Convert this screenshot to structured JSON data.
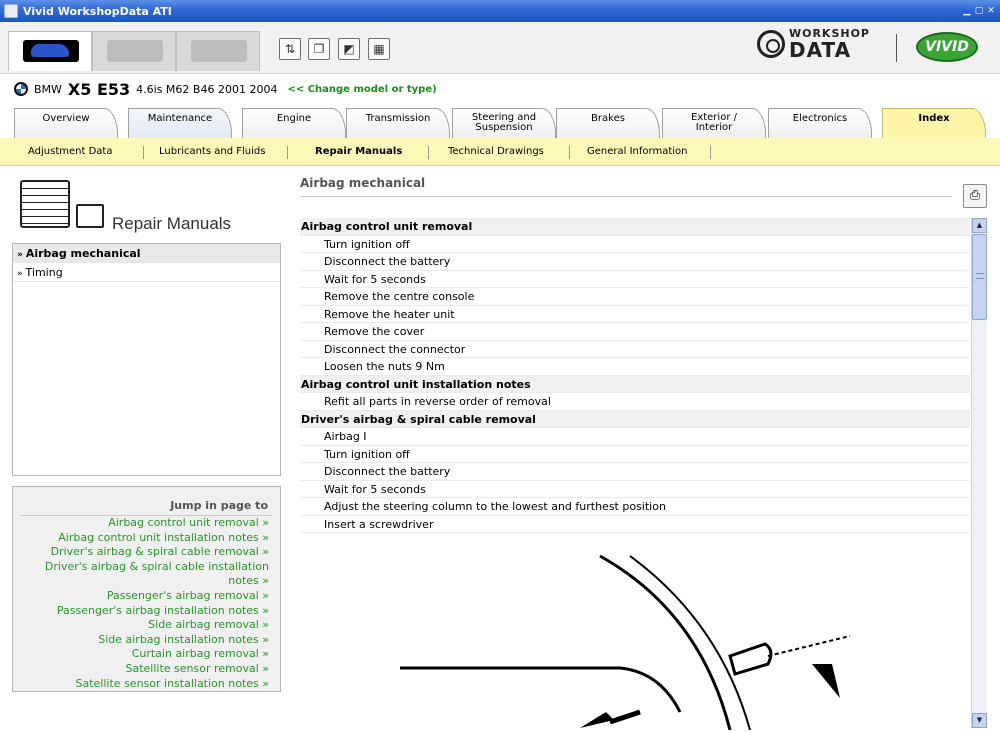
{
  "window": {
    "title": "Vivid WorkshopData ATI"
  },
  "brand": {
    "line1": "WORKSHOP",
    "line2": "DATA",
    "vivid": "VIVID"
  },
  "model": {
    "make": "BMW",
    "name": "X5 E53",
    "detail": "4.6is M62 B46 2001 2004",
    "change_link": "<< Change model or type)"
  },
  "main_tabs": [
    {
      "label": "Overview"
    },
    {
      "label": "Maintenance"
    },
    {
      "label": "Engine"
    },
    {
      "label": "Transmission"
    },
    {
      "label": "Steering and Suspension"
    },
    {
      "label": "Brakes"
    },
    {
      "label": "Exterior / Interior"
    },
    {
      "label": "Electronics"
    },
    {
      "label": "Index"
    }
  ],
  "sub_tabs": [
    {
      "label": "Adjustment Data"
    },
    {
      "label": "Lubricants and Fluids"
    },
    {
      "label": "Repair Manuals"
    },
    {
      "label": "Technical Drawings"
    },
    {
      "label": "General Information"
    }
  ],
  "left": {
    "heading": "Repair Manuals",
    "items": [
      {
        "label": "Airbag mechanical"
      },
      {
        "label": "Timing"
      }
    ],
    "jump_title": "Jump in page to",
    "jump_links": [
      "Airbag control unit removal »",
      "Airbag control unit installation notes »",
      "Driver's airbag & spiral cable removal »",
      "Driver's airbag & spiral cable installation",
      "notes »",
      "Passenger's airbag removal »",
      "Passenger's airbag installation notes »",
      "Side airbag removal »",
      "Side airbag installation notes »",
      "Curtain airbag removal »",
      "Satellite sensor removal »",
      "Satellite sensor installation notes »"
    ]
  },
  "content": {
    "title": "Airbag mechanical",
    "rows": [
      {
        "type": "head",
        "text": "Airbag control unit removal"
      },
      {
        "type": "step",
        "text": "Turn ignition off"
      },
      {
        "type": "step",
        "text": "Disconnect the battery"
      },
      {
        "type": "step",
        "text": "Wait for 5 seconds"
      },
      {
        "type": "step",
        "text": "Remove the centre console"
      },
      {
        "type": "step",
        "text": "Remove the heater unit"
      },
      {
        "type": "step",
        "text": "Remove the cover"
      },
      {
        "type": "step",
        "text": "Disconnect the connector"
      },
      {
        "type": "step",
        "text": "Loosen the nuts 9 Nm"
      },
      {
        "type": "head",
        "text": "Airbag control unit installation notes"
      },
      {
        "type": "step",
        "text": "Refit all parts in reverse order of removal"
      },
      {
        "type": "head",
        "text": "Driver's airbag & spiral cable removal"
      },
      {
        "type": "step",
        "text": "Airbag  I"
      },
      {
        "type": "step",
        "text": "Turn ignition off"
      },
      {
        "type": "step",
        "text": "Disconnect the battery"
      },
      {
        "type": "step",
        "text": "Wait for 5 seconds"
      },
      {
        "type": "step",
        "text": "Adjust the steering column to the lowest and furthest position"
      },
      {
        "type": "step",
        "text": "Insert a screwdriver"
      }
    ]
  },
  "icons": {
    "window": "app-icon",
    "tools": [
      "adjust-tool-icon",
      "copy-pages-icon",
      "drawing-icon",
      "calculator-icon"
    ],
    "print": "printer-icon"
  },
  "colors": {
    "titlebar": "#2f68d6",
    "active_tab": "#fdf5a8",
    "link_green": "#2a942a",
    "vivid_green": "#3aa535"
  }
}
